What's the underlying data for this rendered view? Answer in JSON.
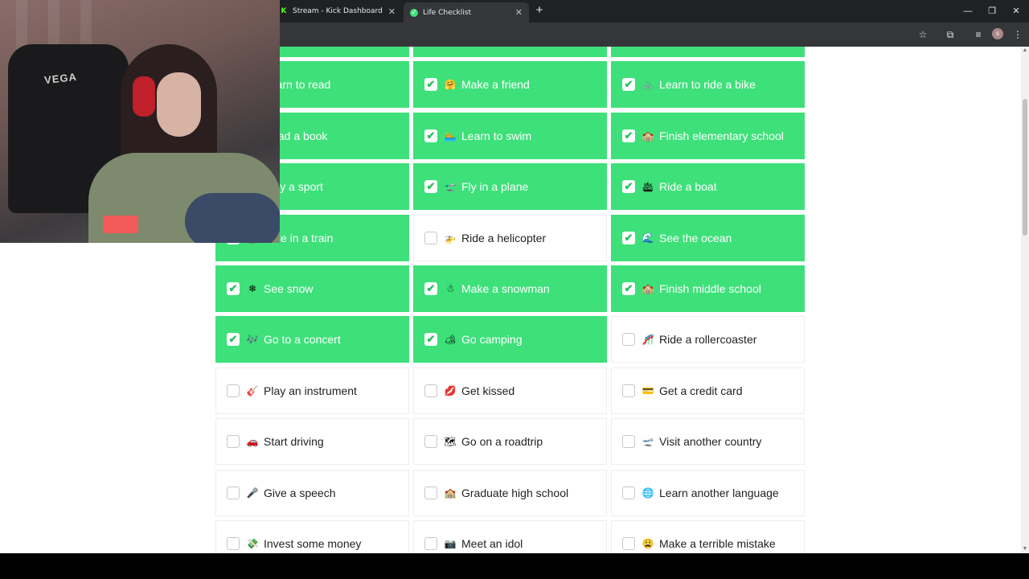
{
  "browser": {
    "tabs": [
      {
        "title": "Stream - Kick Dashboard",
        "favicon": "K",
        "active": false
      },
      {
        "title": "Life Checklist",
        "favicon": "✓",
        "active": true
      }
    ],
    "accent_color": "#3ee07a"
  },
  "grid": {
    "rows": [
      [
        {
          "label": "",
          "emoji": "",
          "checked": true
        },
        {
          "label": "",
          "emoji": "",
          "checked": true
        },
        {
          "label": "",
          "emoji": "",
          "checked": true
        }
      ],
      [
        {
          "label": "Learn to read",
          "emoji": "📖",
          "checked": true
        },
        {
          "label": "Make a friend",
          "emoji": "🤗",
          "checked": true
        },
        {
          "label": "Learn to ride a bike",
          "emoji": "🚲",
          "checked": true
        }
      ],
      [
        {
          "label": "Read a book",
          "emoji": "📚",
          "checked": true
        },
        {
          "label": "Learn to swim",
          "emoji": "🏊",
          "checked": true
        },
        {
          "label": "Finish elementary school",
          "emoji": "🏫",
          "checked": true
        }
      ],
      [
        {
          "label": "Play a sport",
          "emoji": "🏀",
          "checked": true
        },
        {
          "label": "Fly in a plane",
          "emoji": "🛫",
          "checked": true
        },
        {
          "label": "Ride a boat",
          "emoji": "🛳",
          "checked": true
        }
      ],
      [
        {
          "label": "Ride in a train",
          "emoji": "🚆",
          "checked": true
        },
        {
          "label": "Ride a helicopter",
          "emoji": "🚁",
          "checked": false
        },
        {
          "label": "See the ocean",
          "emoji": "🌊",
          "checked": true
        }
      ],
      [
        {
          "label": "See snow",
          "emoji": "❄",
          "checked": true
        },
        {
          "label": "Make a snowman",
          "emoji": "☃",
          "checked": true
        },
        {
          "label": "Finish middle school",
          "emoji": "🏫",
          "checked": true
        }
      ],
      [
        {
          "label": "Go to a concert",
          "emoji": "🎶",
          "checked": true
        },
        {
          "label": "Go camping",
          "emoji": "🏕",
          "checked": true
        },
        {
          "label": "Ride a rollercoaster",
          "emoji": "🎢",
          "checked": false
        }
      ],
      [
        {
          "label": "Play an instrument",
          "emoji": "🎸",
          "checked": false
        },
        {
          "label": "Get kissed",
          "emoji": "💋",
          "checked": false
        },
        {
          "label": "Get a credit card",
          "emoji": "💳",
          "checked": false
        }
      ],
      [
        {
          "label": "Start driving",
          "emoji": "🚗",
          "checked": false
        },
        {
          "label": "Go on a roadtrip",
          "emoji": "🗺",
          "checked": false
        },
        {
          "label": "Visit another country",
          "emoji": "🛫",
          "checked": false
        }
      ],
      [
        {
          "label": "Give a speech",
          "emoji": "🎤",
          "checked": false
        },
        {
          "label": "Graduate high school",
          "emoji": "🏫",
          "checked": false
        },
        {
          "label": "Learn another language",
          "emoji": "🌐",
          "checked": false
        }
      ],
      [
        {
          "label": "Invest some money",
          "emoji": "💸",
          "checked": false
        },
        {
          "label": "Meet an idol",
          "emoji": "📷",
          "checked": false
        },
        {
          "label": "Make a terrible mistake",
          "emoji": "😩",
          "checked": false
        }
      ]
    ]
  },
  "webcam": {
    "chair_brand": "VEGA"
  }
}
